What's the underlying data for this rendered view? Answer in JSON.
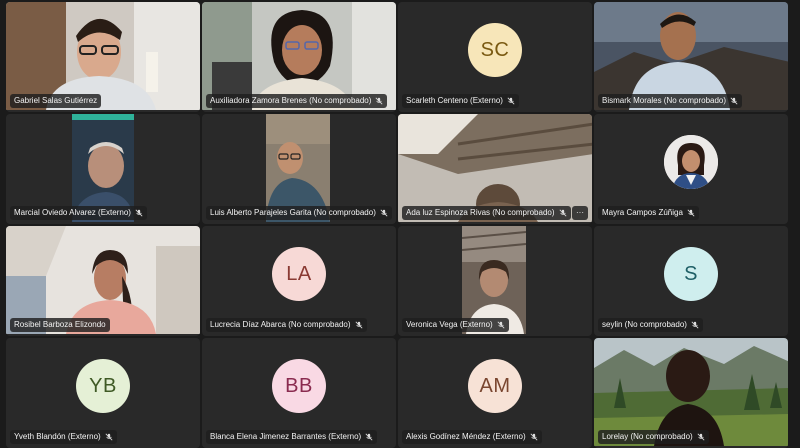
{
  "participants": [
    {
      "name": "Gabriel Salas Gutiérrez",
      "muted": false
    },
    {
      "name": "Auxiliadora Zamora Brenes (No comprobado)",
      "muted": true
    },
    {
      "name": "Scarleth Centeno (Externo)",
      "muted": true,
      "initials": "SC",
      "avatar_bg": "#f7e6b9",
      "avatar_fg": "#7a5a12"
    },
    {
      "name": "Bismark Morales (No comprobado)",
      "muted": true
    },
    {
      "name": "Marcial Oviedo Alvarez (Externo)",
      "muted": true
    },
    {
      "name": "Luis Alberto Parajeles Garita (No comprobado)",
      "muted": true
    },
    {
      "name": "Ada luz Espinoza Rivas (No comprobado)",
      "muted": true,
      "more": "···"
    },
    {
      "name": "Mayra Campos Zúñiga",
      "muted": true
    },
    {
      "name": "Rosibel Barboza Elizondo",
      "muted": false
    },
    {
      "name": "Lucrecia Díaz Abarca (No comprobado)",
      "muted": true,
      "initials": "LA",
      "avatar_bg": "#f7d9d6",
      "avatar_fg": "#8a3a33"
    },
    {
      "name": "Veronica Vega (Externo)",
      "muted": true
    },
    {
      "name": "seylin (No comprobado)",
      "muted": true,
      "initials": "S",
      "avatar_bg": "#cfeeee",
      "avatar_fg": "#1f5f66"
    },
    {
      "name": "Yveth Blandón (Externo)",
      "muted": true,
      "initials": "YB",
      "avatar_bg": "#e5f0d6",
      "avatar_fg": "#3f5a25"
    },
    {
      "name": "Blanca Elena Jimenez Barrantes (Externo)",
      "muted": true,
      "initials": "BB",
      "avatar_bg": "#f9d9e4",
      "avatar_fg": "#8a2b4f"
    },
    {
      "name": "Alexis Godínez Méndez (Externo)",
      "muted": true,
      "initials": "AM",
      "avatar_bg": "#f7e2d6",
      "avatar_fg": "#7a4630"
    },
    {
      "name": "Lorelay (No comprobado)",
      "muted": true
    }
  ]
}
